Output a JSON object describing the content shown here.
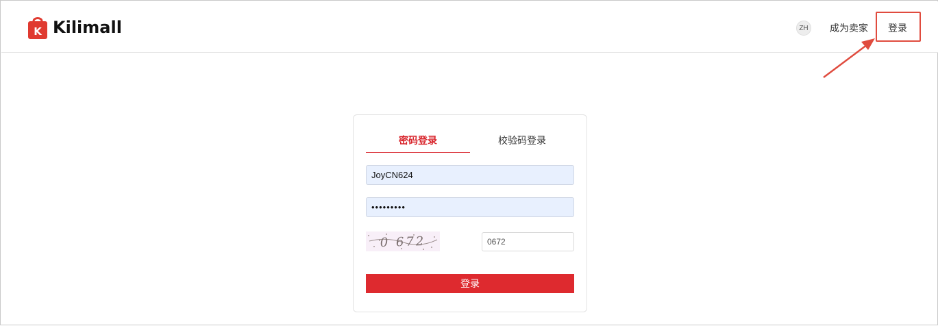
{
  "header": {
    "brand": "Kilimall",
    "brand_mark": "K",
    "language": "ZH",
    "become_seller": "成为卖家",
    "login": "登录"
  },
  "login_card": {
    "tabs": [
      {
        "label": "密码登录",
        "active": true
      },
      {
        "label": "校验码登录",
        "active": false
      }
    ],
    "username_value": "JoyCN624",
    "password_mask": "•••••••••",
    "captcha_image_text": "0 672",
    "captcha_value": "0672",
    "submit_label": "登录"
  },
  "colors": {
    "brand_red": "#d8232a",
    "button_red": "#de2a2f",
    "annotation_red": "#e04b3e",
    "autofill_blue": "#e8f0fe"
  },
  "icons": {
    "logo": "shopping-bag-icon"
  }
}
